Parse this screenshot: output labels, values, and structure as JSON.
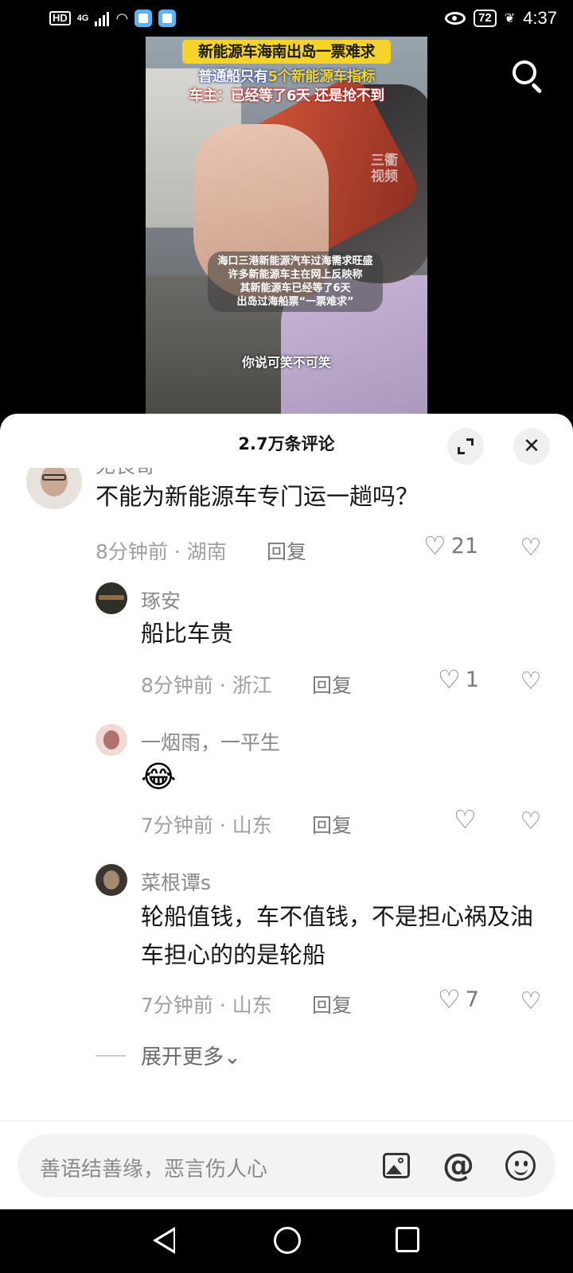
{
  "status_bar": {
    "hd": "HD",
    "network": "4G",
    "battery": "72",
    "time": "4:37"
  },
  "video": {
    "title_banner": "新能源车海南出岛一票难求",
    "line1_prefix": "普通船只有",
    "line1_highlight": "5个新能源车指标",
    "line2": "车主：已经等了6天 还是抢不到",
    "watermark": "三衢视频",
    "notice": [
      "海口三港新能源汽车过海需求旺盛",
      "许多新能源车主在网上反映称",
      "其新能源车已经等了6天",
      "出岛过海船票“一票难求”"
    ],
    "subtitle": "你说可笑不可笑"
  },
  "panel": {
    "title": "2.7万条评论",
    "expand_icon": "expand-icon",
    "close_symbol": "✕"
  },
  "comments": [
    {
      "author": "无畏哥",
      "text": "不能为新能源车专门运一趟吗？",
      "time": "8分钟前 · 湖南",
      "reply": "回复",
      "likes": "21",
      "avatar_color": "#e8e2dc"
    },
    {
      "author": "琢安",
      "text": "船比车贵",
      "time": "8分钟前 · 浙江",
      "reply": "回复",
      "likes": "1",
      "avatar_color": "#2c2f2a"
    },
    {
      "author": "一烟雨，一平生",
      "text": "😂",
      "time": "7分钟前 · 山东",
      "reply": "回复",
      "likes": "",
      "avatar_color": "#f1d9d6"
    },
    {
      "author": "菜根谭s",
      "text": "轮船值钱，车不值钱，不是担心祸及油车担心的的是轮船",
      "time": "7分钟前 · 山东",
      "reply": "回复",
      "likes": "7",
      "avatar_color": "#3a3530"
    }
  ],
  "more": "展开更多⌄",
  "input": {
    "placeholder": "善语结善缘，恶言伤人心",
    "icons": [
      "image-icon",
      "at-icon",
      "emoji-icon"
    ],
    "at_symbol": "@"
  },
  "nav": [
    "back",
    "home",
    "recents"
  ]
}
